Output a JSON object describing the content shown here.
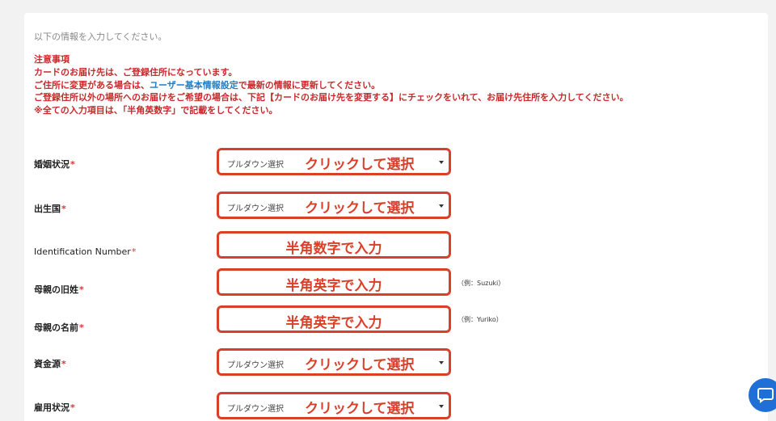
{
  "intro": "以下の情報を入力してください。",
  "notice": {
    "title": "注意事項",
    "line1": "カードのお届け先は、ご登録住所になっています。",
    "line2_pre": "ご住所に変更がある場合は、",
    "line2_link": "ユーザー基本情報設定",
    "line2_post": "で最新の情報に更新してください。",
    "line3": "ご登録住所以外の場所へのお届けをご希望の場合は、下記【カードのお届け先を変更する】にチェックをいれて、お届け先住所を入力してください。",
    "line4": "※全ての入力項目は、「半角英数字」で記載をしてください。"
  },
  "required_mark": "*",
  "fields": {
    "marital": {
      "label": "婚姻状況",
      "placeholder": "プルダウン選択",
      "annotation": "クリックして選択"
    },
    "birth_country": {
      "label": "出生国",
      "placeholder": "プルダウン選択",
      "annotation": "クリックして選択"
    },
    "id_number": {
      "label": "Identification Number",
      "annotation": "半角数字で入力"
    },
    "mother_surname": {
      "label": "母親の旧姓",
      "annotation": "半角英字で入力",
      "example": "（例：Suzuki）"
    },
    "mother_name": {
      "label": "母親の名前",
      "annotation": "半角英字で入力",
      "example": "（例：Yuriko）"
    },
    "fund_source": {
      "label": "資金源",
      "placeholder": "プルダウン選択",
      "annotation": "クリックして選択"
    },
    "employment": {
      "label": "雇用状況",
      "placeholder": "プルダウン選択",
      "annotation": "クリックして選択"
    }
  },
  "chat_icon": "chat-bubble-icon",
  "colors": {
    "notice": "#c9292b",
    "link": "#1f7fc7",
    "annotation": "#d9402a",
    "chat": "#1f6fd6"
  }
}
